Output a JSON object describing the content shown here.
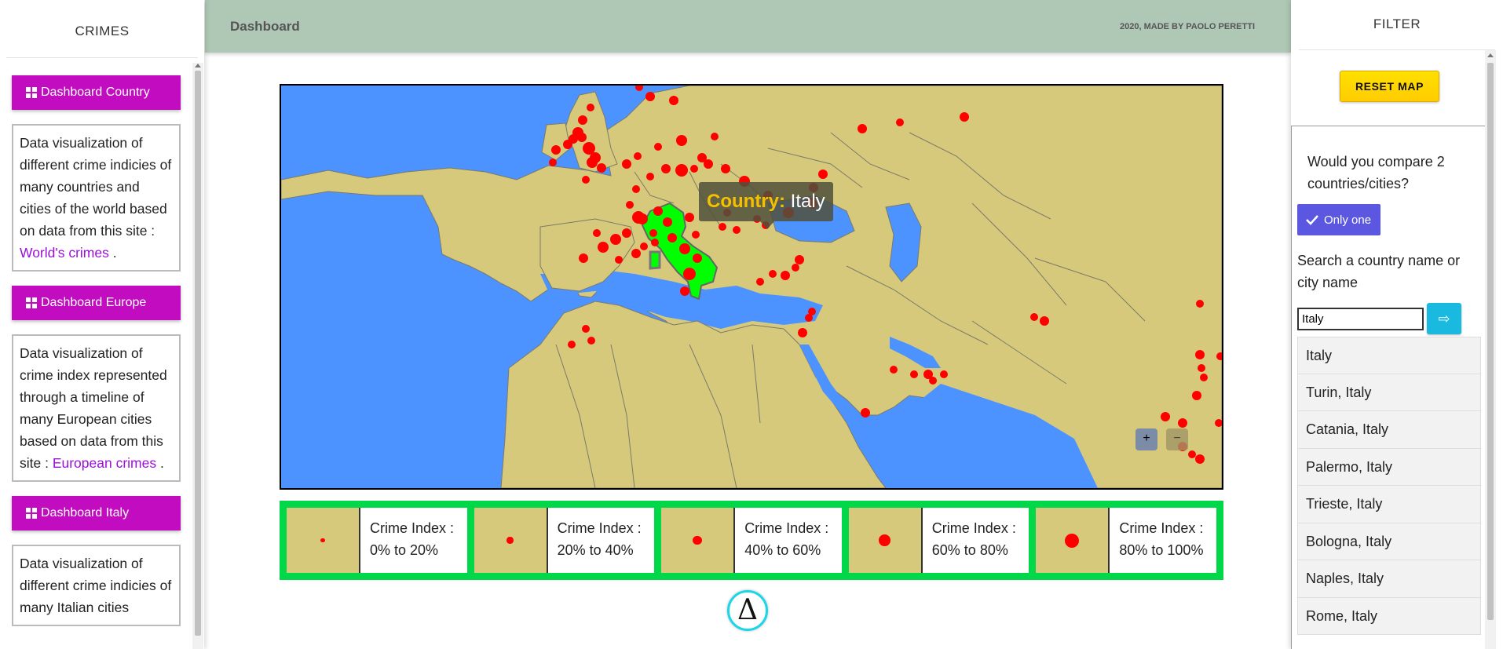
{
  "left": {
    "title": "CRIMES",
    "sections": [
      {
        "button": "Dashboard Country",
        "text": "Data visualization of different crime indicies of many countries and cities of the world based on data from this site : ",
        "link": "World's crimes",
        "end": " ."
      },
      {
        "button": "Dashboard Europe",
        "text": "Data visualization of crime index represented through a timeline of many European cities based on data from this site : ",
        "link": "European crimes",
        "end": " ."
      },
      {
        "button": "Dashboard Italy",
        "text": "Data visualization of different crime indicies of many Italian cities",
        "link": "",
        "end": ""
      }
    ]
  },
  "header": {
    "title": "Dashboard",
    "credit": "2020, MADE BY PAOLO PERETTI"
  },
  "map": {
    "tooltip_key": "Country:",
    "tooltip_value": "Italy",
    "zoom_in": "+",
    "zoom_out": "−",
    "colors": {
      "sea": "#4c93ff",
      "land": "#d7c97c",
      "selected": "#00ff00",
      "marker": "#ff0000"
    }
  },
  "legend": [
    {
      "line1": "Crime Index :",
      "line2": "0% to 20%",
      "level": 0.2
    },
    {
      "line1": "Crime Index :",
      "line2": "20% to 40%",
      "level": 0.4
    },
    {
      "line1": "Crime Index :",
      "line2": "40% to 60%",
      "level": 0.6
    },
    {
      "line1": "Crime Index :",
      "line2": "60% to 80%",
      "level": 0.8
    },
    {
      "line1": "Crime Index :",
      "line2": "80% to 100%",
      "level": 1.0
    }
  ],
  "delta_symbol": "Δ",
  "right": {
    "title": "FILTER",
    "reset_label": "RESET MAP",
    "compare_question": "Would you compare 2 countries/cities?",
    "only_one_label": "Only one",
    "search_label": "Search a country name or city name",
    "search_value": "Italy",
    "go_label": "⇨",
    "results": [
      "Italy",
      "Turin, Italy",
      "Catania, Italy",
      "Palermo, Italy",
      "Trieste, Italy",
      "Bologna, Italy",
      "Naples, Italy",
      "Rome, Italy"
    ]
  }
}
